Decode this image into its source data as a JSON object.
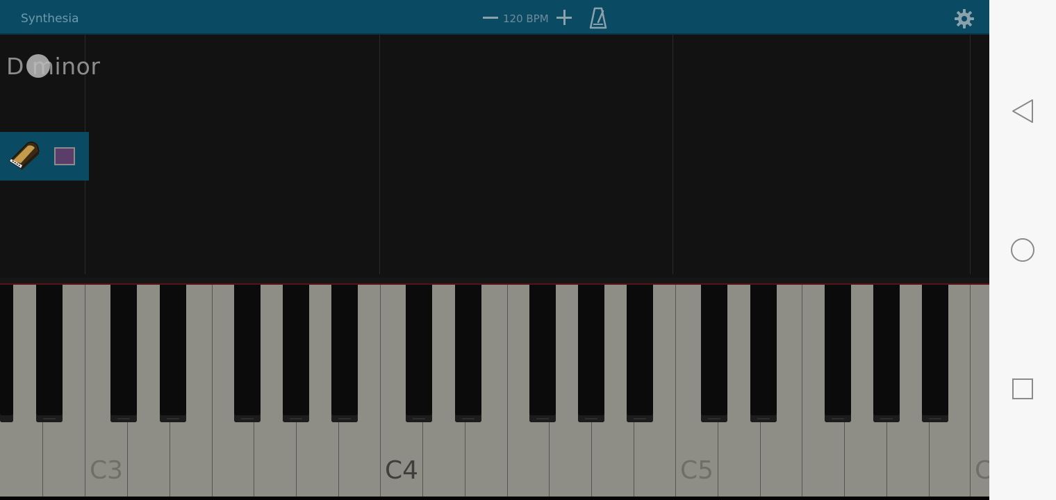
{
  "header": {
    "app_title": "Synthesia",
    "tempo_label": "120 BPM"
  },
  "song": {
    "title": "D minor"
  },
  "keyboard": {
    "labels": [
      "C3",
      "C4",
      "C5"
    ]
  },
  "colors": {
    "topbar": "#0b4a63",
    "background": "#121212",
    "track_color": "#5b3d6a",
    "keyboard_edge": "#5a1218",
    "navbar": "#f7f7f7"
  },
  "icons": {
    "tempo_decrease": "minus-icon",
    "tempo_increase": "plus-icon",
    "metronome": "metronome-icon",
    "settings": "gear-icon",
    "instrument": "piano-icon",
    "nav_back": "back-triangle-icon",
    "nav_home": "home-circle-icon",
    "nav_recent": "recent-square-icon"
  }
}
